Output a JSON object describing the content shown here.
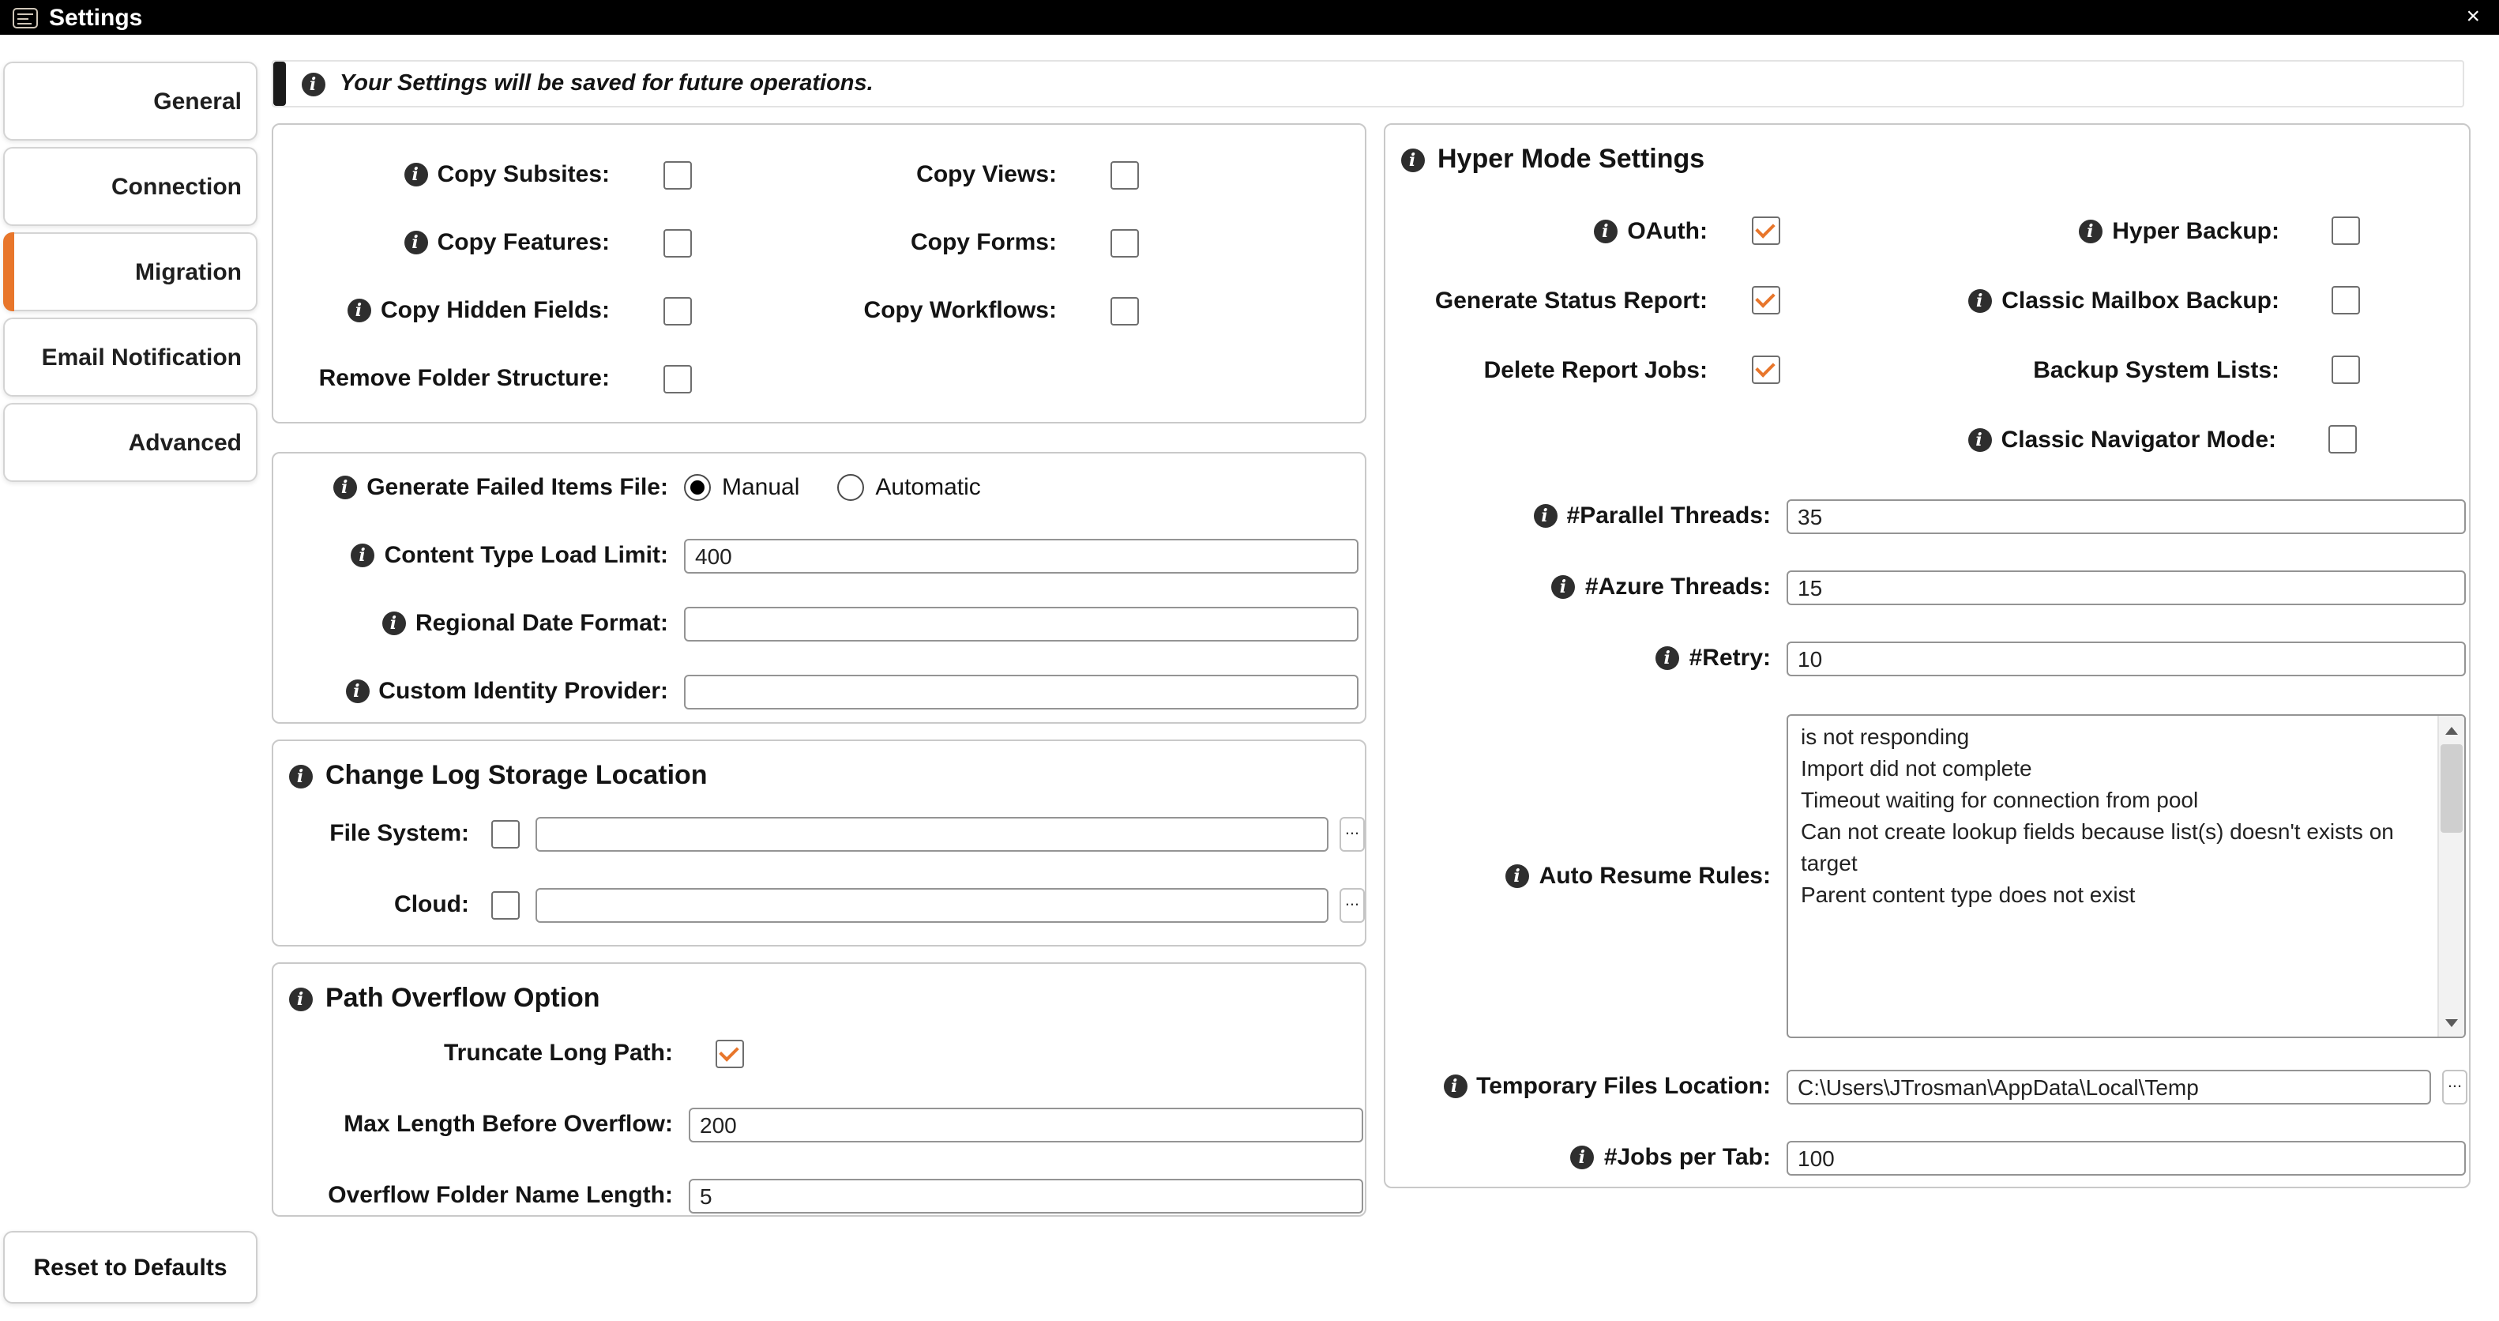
{
  "colors": {
    "accent": "#E8762B",
    "titlebar_bg": "#000000"
  },
  "titlebar": {
    "title": "Settings",
    "close": "×"
  },
  "sidebar": {
    "tabs": [
      {
        "label": "General",
        "selected": false
      },
      {
        "label": "Connection",
        "selected": false
      },
      {
        "label": "Migration",
        "selected": true
      },
      {
        "label": "Email Notification",
        "selected": false
      },
      {
        "label": "Advanced",
        "selected": false
      }
    ],
    "reset_button": "Reset to Defaults"
  },
  "banner": {
    "text": "Your Settings will be saved for future operations."
  },
  "copy_options": {
    "rows": [
      {
        "left": {
          "label": "Copy Subsites:",
          "info": true,
          "checked": false
        },
        "right": {
          "label": "Copy Views:",
          "info": false,
          "checked": false
        }
      },
      {
        "left": {
          "label": "Copy Features:",
          "info": true,
          "checked": false
        },
        "right": {
          "label": "Copy Forms:",
          "info": false,
          "checked": false
        }
      },
      {
        "left": {
          "label": "Copy Hidden Fields:",
          "info": true,
          "checked": false
        },
        "right": {
          "label": "Copy Workflows:",
          "info": false,
          "checked": false
        }
      },
      {
        "left": {
          "label": "Remove Folder Structure:",
          "info": false,
          "checked": false
        }
      }
    ]
  },
  "general_options": {
    "failed_items": {
      "label": "Generate Failed Items File:",
      "info": true,
      "options": [
        {
          "label": "Manual",
          "selected": true
        },
        {
          "label": "Automatic",
          "selected": false
        }
      ]
    },
    "fields": [
      {
        "label": "Content Type Load Limit:",
        "info": true,
        "value": "400"
      },
      {
        "label": "Regional Date Format:",
        "info": true,
        "value": ""
      },
      {
        "label": "Custom Identity Provider:",
        "info": true,
        "value": ""
      }
    ]
  },
  "change_log": {
    "title": "Change Log Storage Location",
    "rows": [
      {
        "label": "File System:",
        "checked": false,
        "value": "",
        "browse": "..."
      },
      {
        "label": "Cloud:",
        "checked": false,
        "value": "",
        "browse": "..."
      }
    ]
  },
  "path_overflow": {
    "title": "Path Overflow Option",
    "truncate": {
      "label": "Truncate Long Path:",
      "checked": true
    },
    "fields": [
      {
        "label": "Max Length Before Overflow:",
        "value": "200"
      },
      {
        "label": "Overflow Folder Name Length:",
        "value": "5"
      }
    ]
  },
  "hyper_mode": {
    "title": "Hyper Mode Settings",
    "checkbox_rows": [
      {
        "left": {
          "label": "OAuth:",
          "info": true,
          "checked": true
        },
        "right": {
          "label": "Hyper Backup:",
          "info": true,
          "checked": false
        }
      },
      {
        "left": {
          "label": "Generate Status Report:",
          "info": false,
          "checked": true
        },
        "right": {
          "label": "Classic Mailbox Backup:",
          "info": true,
          "checked": false
        }
      },
      {
        "left": {
          "label": "Delete Report Jobs:",
          "info": false,
          "checked": true
        },
        "right": {
          "label": "Backup System Lists:",
          "info": false,
          "checked": false
        }
      },
      {
        "right": {
          "label": "Classic Navigator Mode:",
          "info": true,
          "checked": false
        }
      }
    ],
    "fields": [
      {
        "label": "#Parallel Threads:",
        "info": true,
        "value": "35"
      },
      {
        "label": "#Azure Threads:",
        "info": true,
        "value": "15"
      },
      {
        "label": "#Retry:",
        "info": true,
        "value": "10"
      }
    ],
    "auto_resume": {
      "label": "Auto Resume Rules:",
      "info": true,
      "value": "is not responding\nImport did not complete\nTimeout waiting for connection from pool\nCan not create lookup fields because list(s) doesn't exists on target\nParent content type does not exist"
    },
    "temp_files": {
      "label": "Temporary Files Location:",
      "info": true,
      "value": "C:\\Users\\JTrosman\\AppData\\Local\\Temp",
      "browse": "..."
    },
    "jobs_per_tab": {
      "label": "#Jobs per Tab:",
      "info": true,
      "value": "100"
    }
  }
}
